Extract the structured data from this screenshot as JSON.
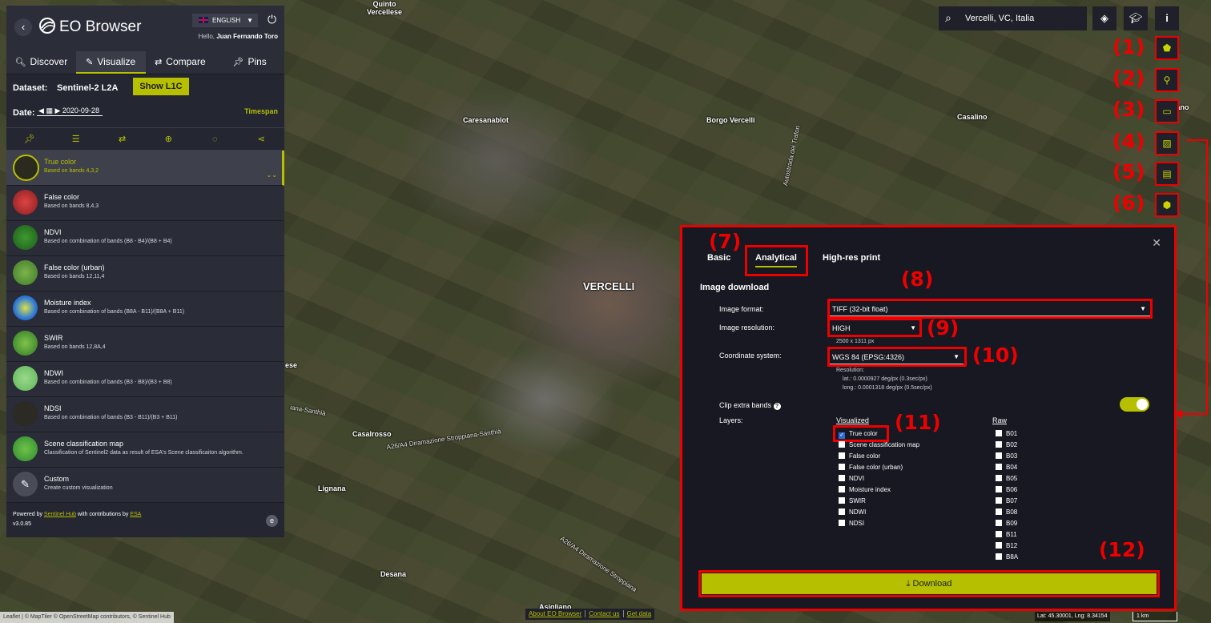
{
  "app": {
    "name": "EO Browser",
    "language": "ENGLISH",
    "greeting": "Hello,",
    "user": "Juan Fernando Toro"
  },
  "tabs": [
    {
      "label": "Discover"
    },
    {
      "label": "Visualize"
    },
    {
      "label": "Compare"
    },
    {
      "label": "Pins"
    }
  ],
  "dataset": {
    "label": "Dataset:",
    "value": "Sentinel-2 L2A",
    "toggle_label": "Show L1C"
  },
  "date": {
    "label": "Date:",
    "value": "2020-09-28",
    "timespan": "Timespan"
  },
  "layers": [
    {
      "name": "True color",
      "desc": "Based on bands 4,3,2",
      "color": "#2a2a1e"
    },
    {
      "name": "False color",
      "desc": "Based on bands 8,4,3",
      "color": "#b52a2a"
    },
    {
      "name": "NDVI",
      "desc": "Based on combination of bands (B8 - B4)/(B8 + B4)",
      "color": "#2f8a2a"
    },
    {
      "name": "False color (urban)",
      "desc": "Based on bands 12,11,4",
      "color": "#5a9a3a"
    },
    {
      "name": "Moisture index",
      "desc": "Based on combination of bands (B8A - B11)/(B8A + B11)",
      "color": "#2e7ad6"
    },
    {
      "name": "SWIR",
      "desc": "Based on bands 12,8A,4",
      "color": "#49a02e"
    },
    {
      "name": "NDWI",
      "desc": "Based on combination of bands (B3 - B8)/(B3 + B8)",
      "color": "#7acc6a"
    },
    {
      "name": "NDSI",
      "desc": "Based on combination of bands (B3 - B11)/(B3 + B11)",
      "color": "#2c2a25"
    },
    {
      "name": "Scene classification map",
      "desc": "Classification of Sentinel2 data as result of ESA's Scene classificaiton algorithm.",
      "color": "#3aa53a"
    },
    {
      "name": "Custom",
      "desc": "Create custom visualization",
      "color": "#4a4c58"
    }
  ],
  "footer": {
    "powered": "Powered by",
    "sentinel_hub": "Sentinel Hub",
    "contrib": "with contributions by",
    "esa": "ESA",
    "version": "v3.0.85"
  },
  "search": {
    "value": "Vercelli, VC, Italia"
  },
  "annotations": [
    "(1)",
    "(2)",
    "(3)",
    "(4)",
    "(5)",
    "(6)",
    "(7)",
    "(8)",
    "(9)",
    "(10)",
    "(11)",
    "(12)"
  ],
  "map_labels": {
    "quinto": "Quinto\nVercellese",
    "caresanablot": "Caresanablot",
    "borgo": "Borgo Vercelli",
    "casalino": "Casalino",
    "vercelli": "VERCELLI",
    "casalrosso": "Casalrosso",
    "lignana": "Lignana",
    "desana": "Desana",
    "asigliano": "Asigliano",
    "ese": "ese",
    "grano": "Grano",
    "road1": "A26/A4 Diramazione Stroppiana-Santhià",
    "road2": "A26/A4 Diramazione Stroppiana",
    "road3": "Autostrada dei Trafori",
    "road4": "iana-Santhià"
  },
  "panel": {
    "tabs": [
      "Basic",
      "Analytical",
      "High-res print"
    ],
    "title": "Image download",
    "format_label": "Image format:",
    "format_value": "TIFF (32-bit float)",
    "res_label": "Image resolution:",
    "res_value": "HIGH",
    "res_px": "2500 x 1311 px",
    "crs_label": "Coordinate system:",
    "crs_value": "WGS 84 (EPSG:4326)",
    "resolution_heading": "Resolution:",
    "lat": "lat.: 0.0000927 deg/px (0.3sec/px)",
    "long": "long.: 0.0001318 deg/px (0.5sec/px)",
    "clip_label": "Clip extra bands",
    "layers_label": "Layers:",
    "visualized_heading": "Visualized",
    "raw_heading": "Raw",
    "visualized": [
      "True color",
      "Scene classification map",
      "False color",
      "False color (urban)",
      "NDVI",
      "Moisture index",
      "SWIR",
      "NDWI",
      "NDSI"
    ],
    "raw": [
      "B01",
      "B02",
      "B03",
      "B04",
      "B05",
      "B06",
      "B07",
      "B08",
      "B09",
      "B11",
      "B12",
      "B8A"
    ],
    "download": "Download"
  },
  "bottom": {
    "attribution": "Leaflet | © MapTiler © OpenStreetMap contributors, © Sentinel Hub",
    "about": "About EO Browser",
    "contact": "Contact us",
    "getdata": "Get data",
    "coords": "Lat: 45.30001, Lng: 8.34154",
    "scale": "1 km"
  },
  "colors": {
    "accent": "#b7c000",
    "annotation": "#ee0000",
    "panel": "#171821"
  }
}
